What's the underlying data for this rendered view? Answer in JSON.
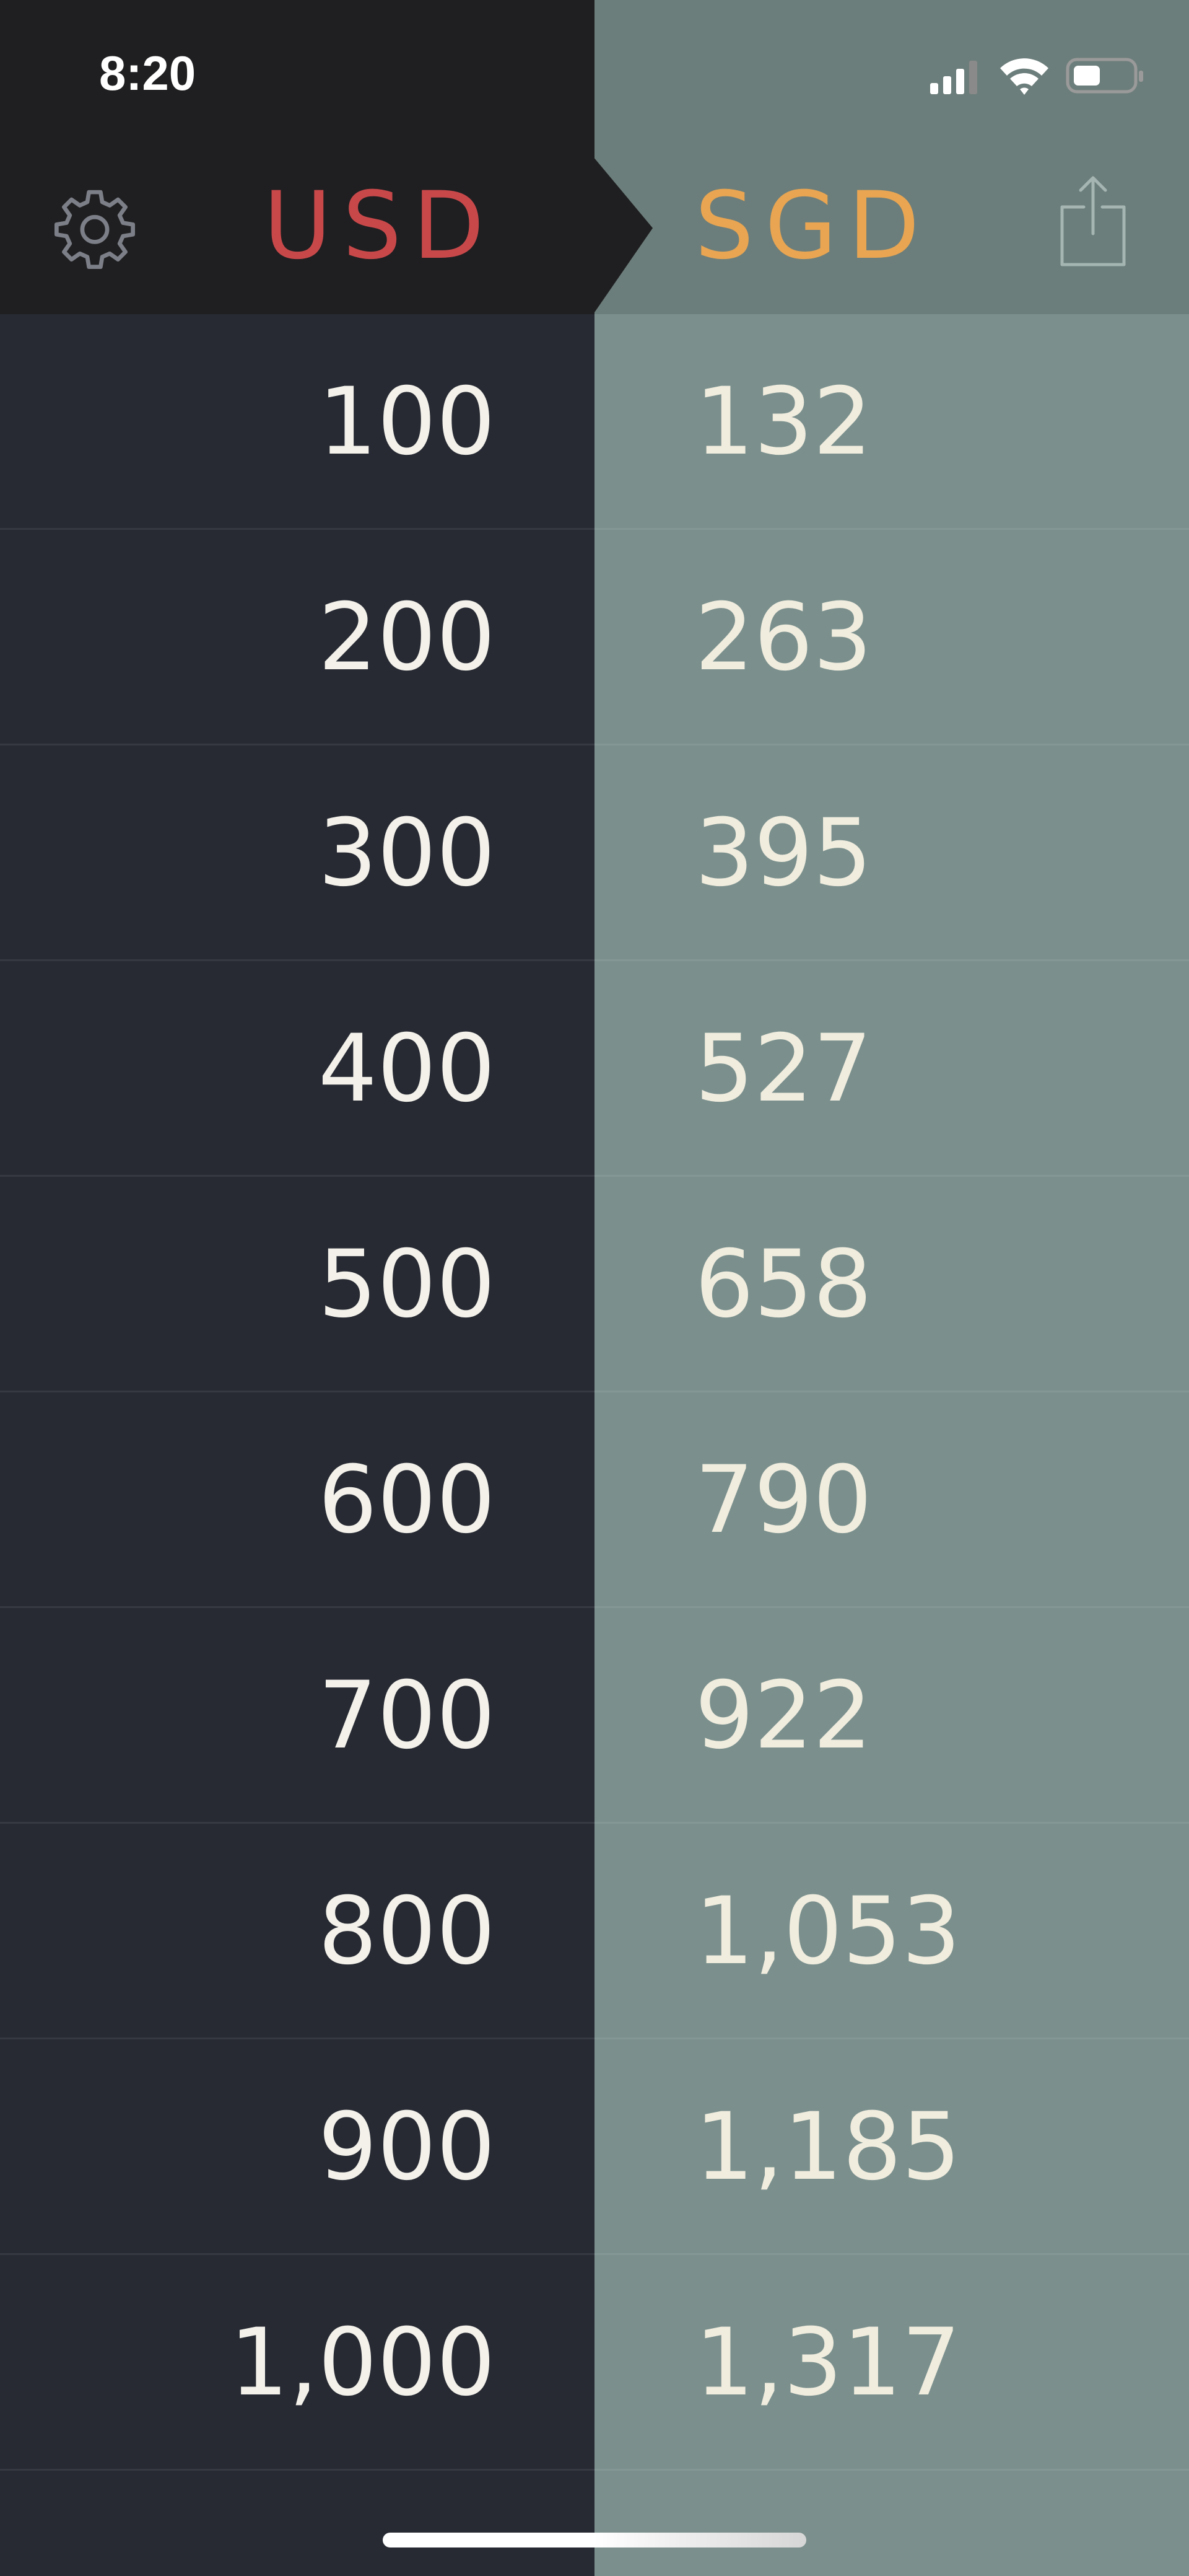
{
  "status_bar": {
    "time": "8:20",
    "icons": [
      "cellular-signal-icon",
      "wifi-icon",
      "battery-icon"
    ]
  },
  "header": {
    "settings_icon": "gear-icon",
    "from_currency": "USD",
    "to_currency": "SGD",
    "share_icon": "share-icon"
  },
  "colors": {
    "from_currency": "#c8484a",
    "to_currency": "#e9a552",
    "left_panel": "#272a33",
    "right_panel": "#7b908d"
  },
  "rows": [
    {
      "from": "100",
      "to": "132"
    },
    {
      "from": "200",
      "to": "263"
    },
    {
      "from": "300",
      "to": "395"
    },
    {
      "from": "400",
      "to": "527"
    },
    {
      "from": "500",
      "to": "658"
    },
    {
      "from": "600",
      "to": "790"
    },
    {
      "from": "700",
      "to": "922"
    },
    {
      "from": "800",
      "to": "1,053"
    },
    {
      "from": "900",
      "to": "1,185"
    },
    {
      "from": "1,000",
      "to": "1,317"
    }
  ]
}
